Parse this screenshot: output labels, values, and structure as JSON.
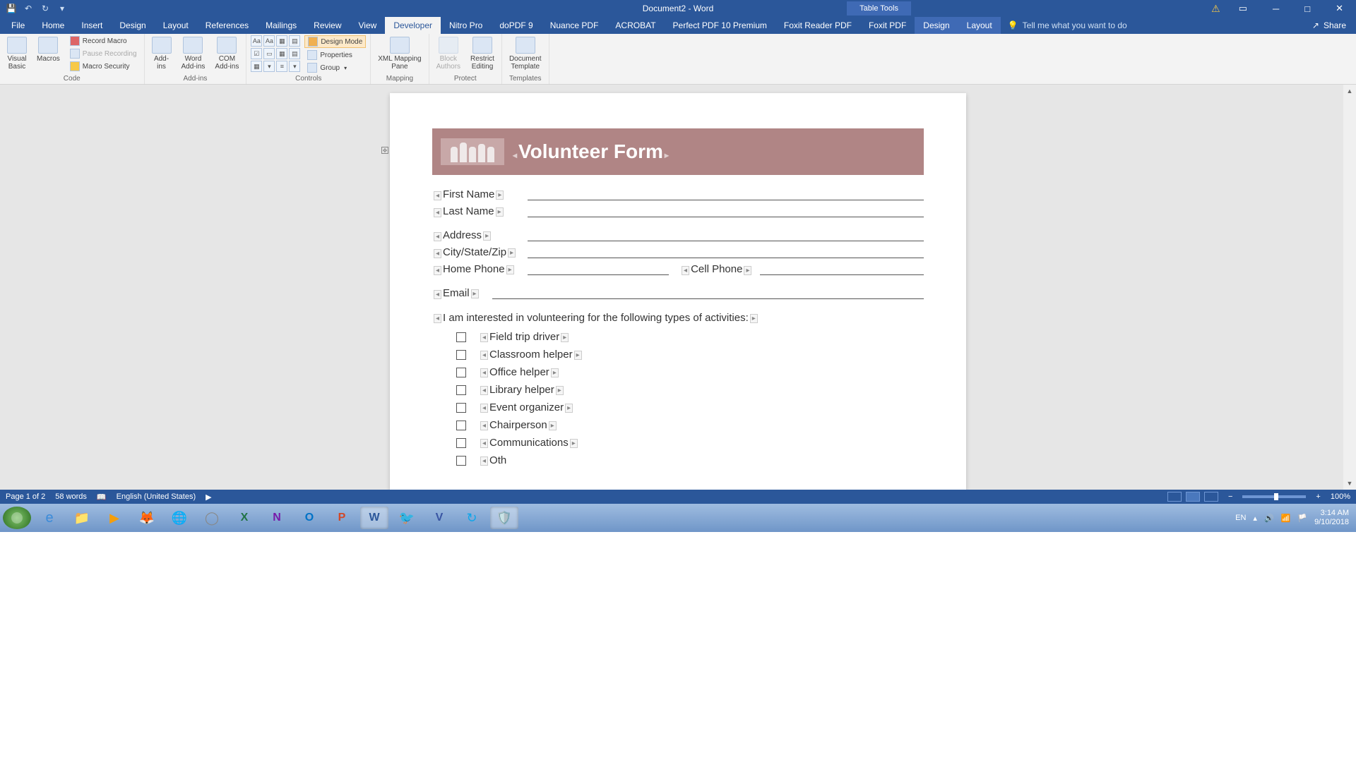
{
  "titlebar": {
    "document_title": "Document2 - Word",
    "tabletools": "Table Tools"
  },
  "tabs": {
    "file": "File",
    "home": "Home",
    "insert": "Insert",
    "design": "Design",
    "layout": "Layout",
    "references": "References",
    "mailings": "Mailings",
    "review": "Review",
    "view": "View",
    "developer": "Developer",
    "nitro": "Nitro Pro",
    "dopdf": "doPDF 9",
    "nuance": "Nuance PDF",
    "acrobat": "ACROBAT",
    "perfectpdf": "Perfect PDF 10 Premium",
    "foxit": "Foxit Reader PDF",
    "foxitpdf": "Foxit PDF",
    "tbl_design": "Design",
    "tbl_layout": "Layout",
    "tellme": "Tell me what you want to do",
    "share": "Share"
  },
  "ribbon": {
    "code": {
      "vb": "Visual\nBasic",
      "macros": "Macros",
      "record": "Record Macro",
      "pause": "Pause Recording",
      "security": "Macro Security",
      "label": "Code"
    },
    "addins": {
      "addins": "Add-\nins",
      "word": "Word\nAdd-ins",
      "com": "COM\nAdd-ins",
      "label": "Add-ins"
    },
    "controls": {
      "design": "Design Mode",
      "properties": "Properties",
      "group": "Group",
      "label": "Controls"
    },
    "mapping": {
      "xml": "XML Mapping\nPane",
      "label": "Mapping"
    },
    "protect": {
      "block": "Block\nAuthors",
      "restrict": "Restrict\nEditing",
      "label": "Protect"
    },
    "templates": {
      "doc": "Document\nTemplate",
      "label": "Templates"
    }
  },
  "form": {
    "title": "Volunteer Form",
    "first_name": "First Name",
    "last_name": "Last Name",
    "address": "Address",
    "city": "City/State/Zip",
    "home_phone": "Home Phone",
    "cell_phone": "Cell Phone",
    "email": "Email",
    "interest": "I am interested in volunteering for the following types of activities:",
    "activities": {
      "a0": "Field trip driver",
      "a1": "Classroom helper",
      "a2": "Office helper",
      "a3": "Library helper",
      "a4": "Event organizer",
      "a5": "Chairperson",
      "a6": "Communications",
      "a7": "Oth"
    }
  },
  "status": {
    "page": "Page 1 of 2",
    "words": "58 words",
    "lang": "English (United States)",
    "zoom": "100%"
  },
  "taskbar": {
    "lang": "EN",
    "time": "3:14 AM",
    "date": "9/10/2018"
  }
}
